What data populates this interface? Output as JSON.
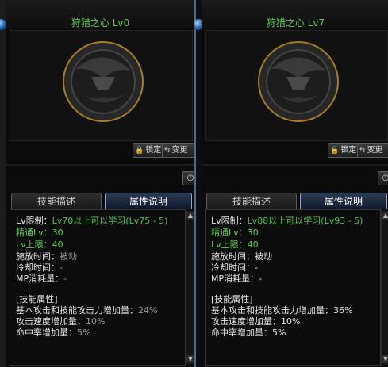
{
  "panels": [
    {
      "title": "狩猎之心 Lv0",
      "buttons": {
        "lock": "锁定",
        "change": "变更"
      },
      "tabs": {
        "skill_desc": "技能描述",
        "attr_desc": "属性说明"
      },
      "lv_limit_label": "Lv限制：",
      "lv_limit_value": "Lv70以上可以学习(Lv75 - 5)",
      "normal_lv": "精通Lv：30",
      "max_lv": "Lv上限：40",
      "cast_time_label": "施放时间：",
      "cast_time_value": "被动",
      "cooldown_label": "冷却时间：",
      "cooldown_value": "-",
      "mp_label": "MP消耗量：",
      "mp_value": "-",
      "attr_header": "[技能属性]",
      "atk_label": "基本攻击和技能攻击力增加量：",
      "atk_value": "24%",
      "speed_label": "攻击速度增加量：",
      "speed_value": "10%",
      "hit_label": "命中率增加量：",
      "hit_value": "5%"
    },
    {
      "title": "狩猎之心 Lv7",
      "buttons": {
        "lock": "锁定",
        "change": "变更"
      },
      "tabs": {
        "skill_desc": "技能描述",
        "attr_desc": "属性说明"
      },
      "lv_limit_label": "Lv限制：",
      "lv_limit_value": "Lv88以上可以学习(Lv93 - 5)",
      "normal_lv": "精通Lv：30",
      "max_lv": "Lv上限：40",
      "cast_time_label": "施放时间：",
      "cast_time_value": "被动",
      "cooldown_label": "冷却时间：",
      "cooldown_value": "-",
      "mp_label": "MP消耗量：",
      "mp_value": "-",
      "attr_header": "[技能属性]",
      "atk_label": "基本攻击和技能攻击力增加量：",
      "atk_value": "36%",
      "speed_label": "攻击速度增加量：",
      "speed_value": "10%",
      "hit_label": "命中率增加量：",
      "hit_value": "5%"
    }
  ],
  "colors": {
    "title_green": "#58d04a",
    "value_gray": "#9a9a9a",
    "tab_active": "#2a3a52"
  },
  "icons": {
    "lock": "lock-icon",
    "change": "swap-icon",
    "clock": "clock-icon",
    "emblem": "dungeon-fighter-emblem"
  }
}
